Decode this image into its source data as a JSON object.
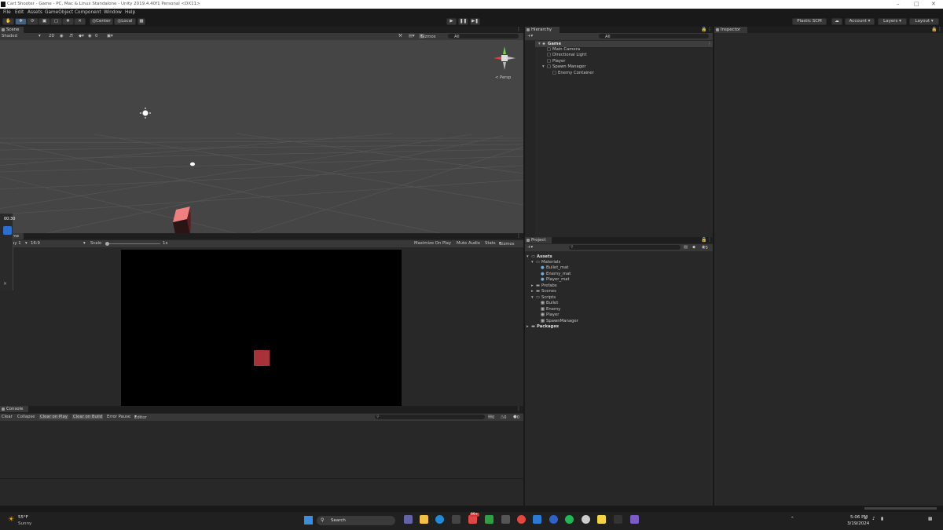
{
  "window": {
    "title": "Cart Shooter - Game - PC, Mac & Linux Standalone - Unity 2019.4.40f1 Personal <DX11>"
  },
  "menu": [
    "File",
    "Edit",
    "Assets",
    "GameObject",
    "Component",
    "Window",
    "Help"
  ],
  "toolbar": {
    "pivot": "Center",
    "space": "Local",
    "plastic": "Plastic SCM",
    "account": "Account",
    "layers": "Layers",
    "layout": "Layout"
  },
  "scene": {
    "tab": "Scene",
    "shading": "Shaded",
    "mode2d": "2D",
    "gizmos": "Gizmos",
    "search_placeholder": "All",
    "persp": "< Persp",
    "fx_count": "0"
  },
  "game": {
    "tab": "Game",
    "display": "Display 1",
    "aspect": "16:9",
    "scale_label": "Scale",
    "scale_value": "1x",
    "maximize": "Maximize On Play",
    "mute": "Mute Audio",
    "stats": "Stats",
    "gizmos": "Gizmos"
  },
  "overlay": {
    "time": "00:30"
  },
  "hierarchy": {
    "tab": "Hierarchy",
    "search_placeholder": "All",
    "scene": "Game",
    "items": [
      "Main Camera",
      "Directional Light",
      "Player",
      "Spawn Manager",
      "Enemy Container"
    ]
  },
  "project": {
    "tab": "Project",
    "count": "5",
    "root": "Assets",
    "materials": "Materials",
    "mats": [
      "Bullet_mat",
      "Enemy_mat",
      "Player_mat"
    ],
    "prefabs": "Prefabs",
    "scenes": "Scenes",
    "scripts": "Scripts",
    "script_items": [
      "Bullet",
      "Enemy",
      "Player",
      "SpawnManager"
    ],
    "packages": "Packages"
  },
  "inspector": {
    "tab": "Inspector"
  },
  "console": {
    "tab": "Console",
    "clear": "Clear",
    "collapse": "Collapse",
    "clear_on_play": "Clear on Play",
    "clear_on_build": "Clear on Build",
    "error_pause": "Error Pause",
    "editor": "Editor",
    "logs": "0",
    "warnings": "0",
    "errors": "0"
  },
  "taskbar": {
    "temp": "55°F",
    "weather": "Sunny",
    "search": "Search",
    "time": "5:06 PM",
    "date": "3/19/2024",
    "badge": "99+"
  },
  "colors": {
    "accent": "#2c5d87",
    "cube_scene": "#f08080",
    "cube_game": "#a8323a"
  }
}
